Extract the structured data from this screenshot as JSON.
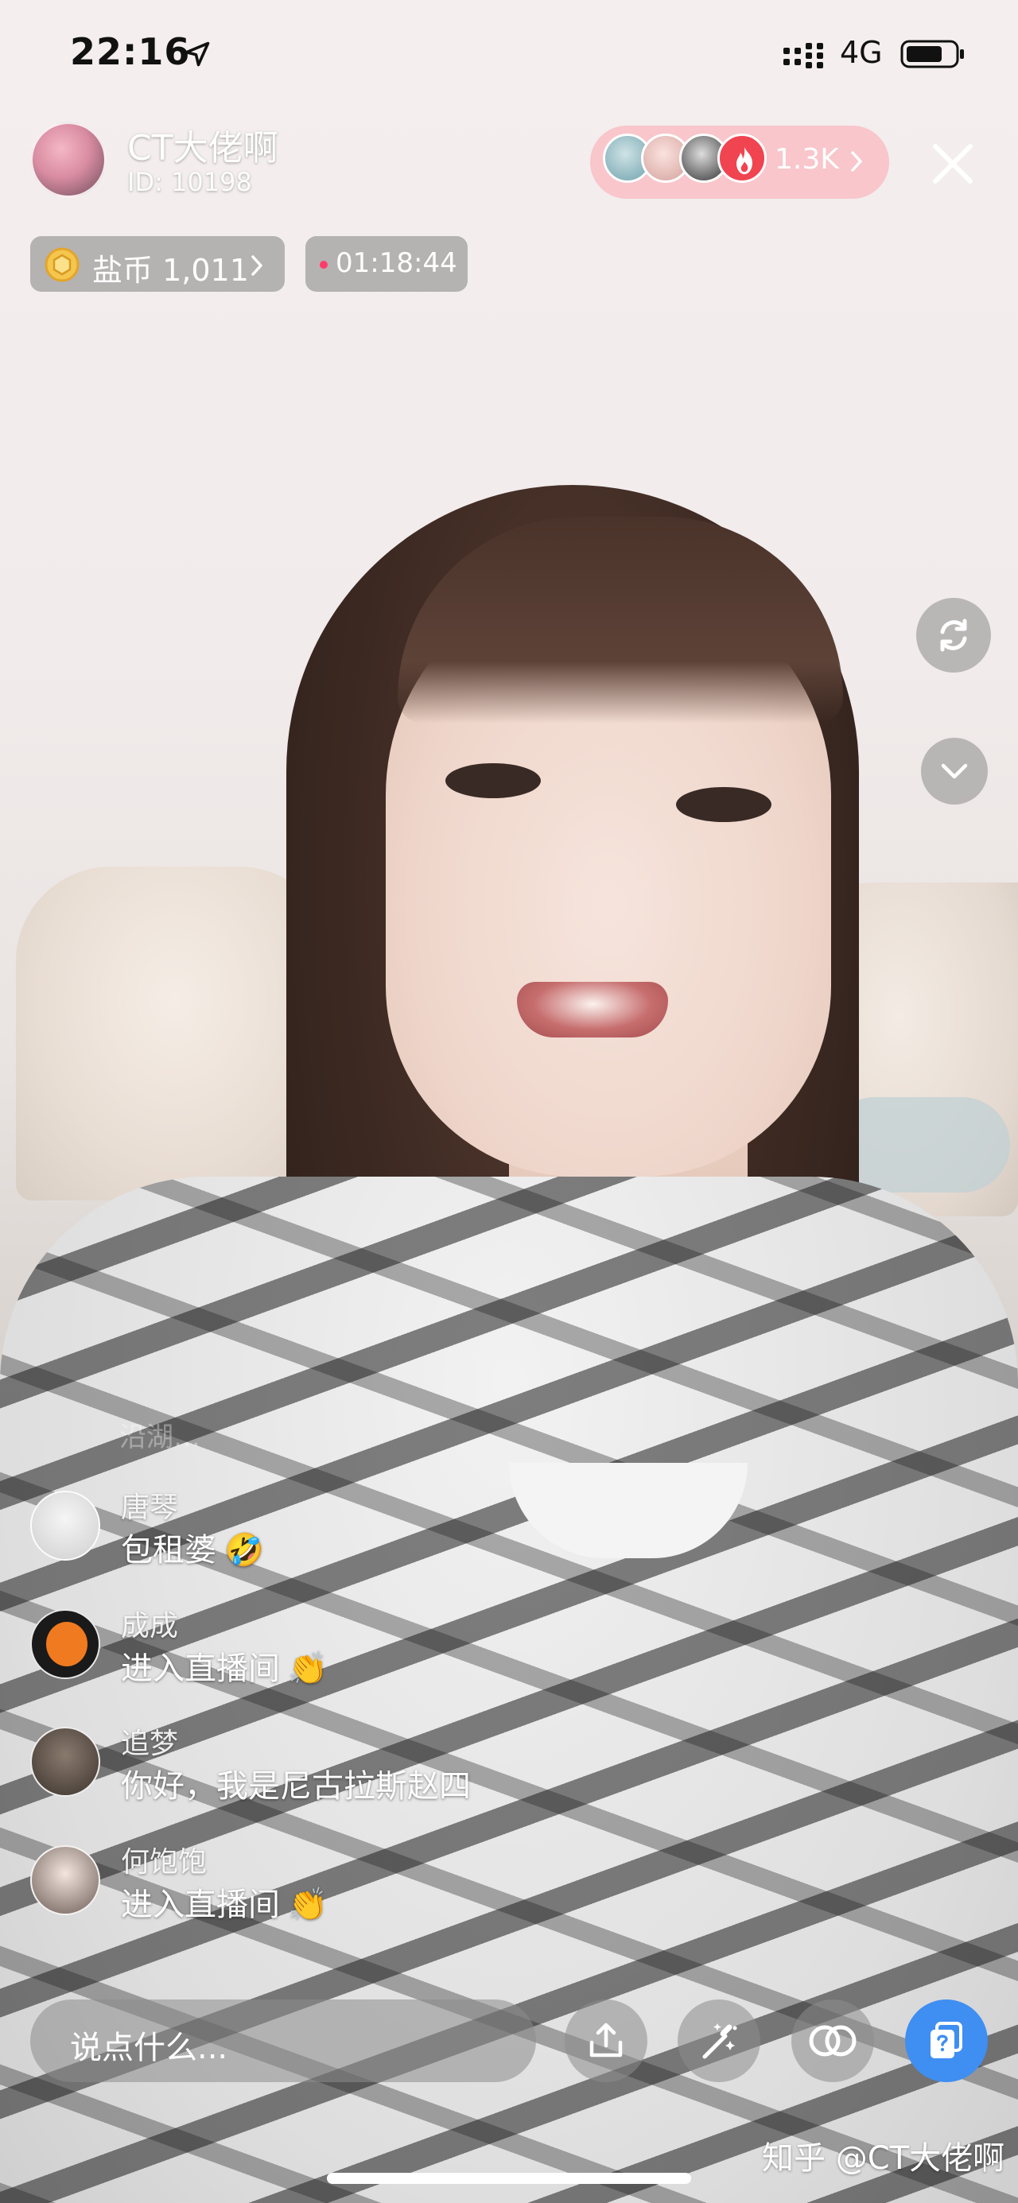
{
  "status_bar": {
    "time": "22:16",
    "network": "4G"
  },
  "host": {
    "name": "CT大佬啊",
    "id": "ID: 10198"
  },
  "viewers": {
    "count": "1.3K"
  },
  "coins": {
    "label": "盐币 1,011"
  },
  "live": {
    "duration": "01:18:44"
  },
  "chat": {
    "faded_text": "沿湖…",
    "messages": [
      {
        "user": "唐琴",
        "text": "包租婆",
        "emoji": "🤣"
      },
      {
        "user": "成成",
        "text": "进入直播间",
        "emoji": "👏"
      },
      {
        "user": "追梦",
        "text": "你好，我是尼古拉斯赵四"
      },
      {
        "user": "何饱饱",
        "text": "进入直播间",
        "emoji": "👏"
      }
    ]
  },
  "bottom_bar": {
    "comment_placeholder": "说点什么..."
  },
  "watermark": "知乎 @CT大佬啊",
  "icons": {
    "location": "location-arrow-icon",
    "signal": "cellular-signal-icon",
    "battery": "battery-icon",
    "close": "close-icon",
    "flame": "flame-icon",
    "coin": "coin-icon",
    "flip_camera": "flip-camera-icon",
    "collapse": "chevron-down-icon",
    "share": "share-icon",
    "effects": "magic-wand-icon",
    "link_mic": "linked-circles-icon",
    "help": "help-cards-icon"
  },
  "colors": {
    "live_dot": "#ff3b6a",
    "viewer_pill": "#f8bec4",
    "help_button": "#3f8ef2"
  }
}
